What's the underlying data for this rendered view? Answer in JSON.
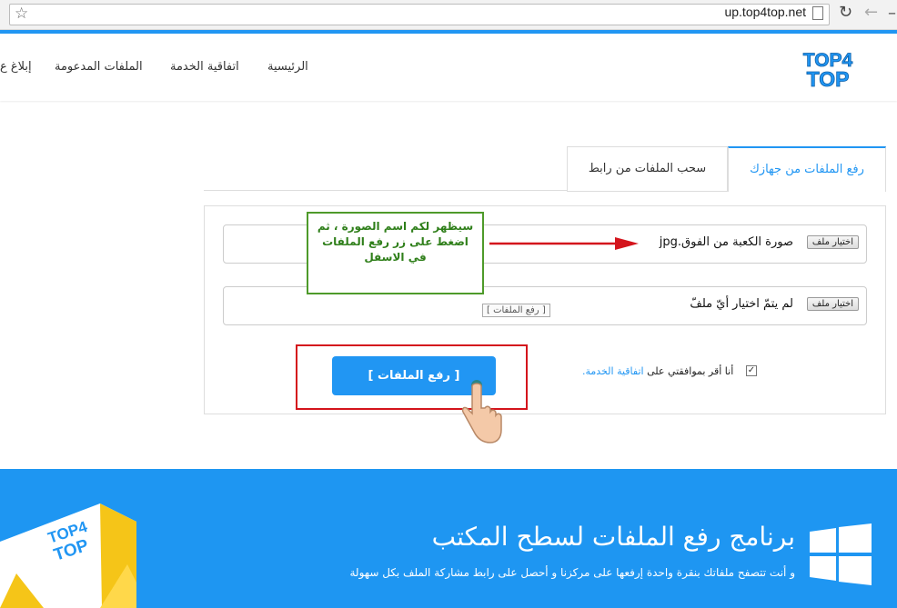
{
  "browser": {
    "url": "up.top4top.net"
  },
  "header": {
    "logo_line1": "TOP4",
    "logo_line2": "TOP",
    "nav": [
      {
        "label": "الرئيسية"
      },
      {
        "label": "اتفاقية الخدمة"
      },
      {
        "label": "الملفات المدعومة"
      },
      {
        "label": "إبلاغ ع"
      }
    ]
  },
  "tabs": [
    {
      "label": "رفع الملفات من جهازك",
      "active": true
    },
    {
      "label": "سحب الملفات من رابط",
      "active": false
    }
  ],
  "form": {
    "choose_file_label": "اختيار ملف",
    "file1_name": "صورة الكعبة من الفوق.jpg",
    "file2_name": "لم يتمّ اختيار أيّ ملفّ",
    "tooltip": "[ رفع الملفات ]",
    "upload_label": "[ رفع الملفات ]",
    "agree_prefix": "أنا أقر بموافقتي على",
    "agree_link": "اتفاقية الخدمة."
  },
  "annotation": {
    "text": "سيظهر لكم اسم الصورة ، ثم اضغط على زر رفع الملفات في الاسفل"
  },
  "footer": {
    "title": "برنامج رفع الملفات لسطح المكتب",
    "subtitle": "و أنت تتصفح ملفاتك بنقرة واحدة إرفعها على مركزنا و أحصل على رابط مشاركة الملف بكل سهولة",
    "box_logo_line1": "TOP4",
    "box_logo_line2": "TOP"
  },
  "colors": {
    "accent": "#2196f3",
    "annotation_green": "#4e9a2a",
    "highlight_red": "#d4141c"
  }
}
